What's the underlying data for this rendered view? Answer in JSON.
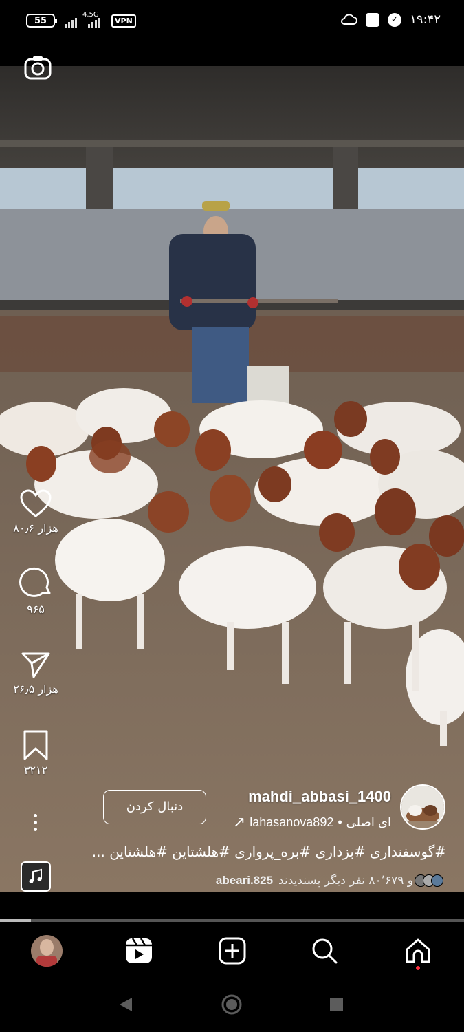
{
  "status_bar": {
    "battery": "55",
    "network": "4.5G",
    "vpn": "VPN",
    "time": "۱۹:۴۲"
  },
  "reel": {
    "username": "mahdi_abbasi_1400",
    "follow_label": "دنبال کردن",
    "audio_original": "ای اصلی",
    "audio_separator": "•",
    "audio_user": "lahasanova892",
    "caption": "#گوسفنداری #بزداری #بره_پرواری #هلشتاین #هلشتاین ...",
    "liked_by_user": "abeari.825",
    "liked_by_text": "و ۸۰٬۶۷۹ نفر دیگر پسندیدند",
    "progress": 0.066
  },
  "actions": {
    "likes": "۸۰٫۶ هزار",
    "comments": "۹۶۵",
    "shares": "۲۶٫۵ هزار",
    "saves": "۳۲۱۲"
  },
  "icons": [
    "camera-icon",
    "heart-icon",
    "comment-icon",
    "share-icon",
    "bookmark-icon",
    "more-icon",
    "music-icon",
    "reels-icon",
    "create-icon",
    "search-icon",
    "home-icon"
  ],
  "colors": {
    "notification_dot": "#ff3040"
  }
}
